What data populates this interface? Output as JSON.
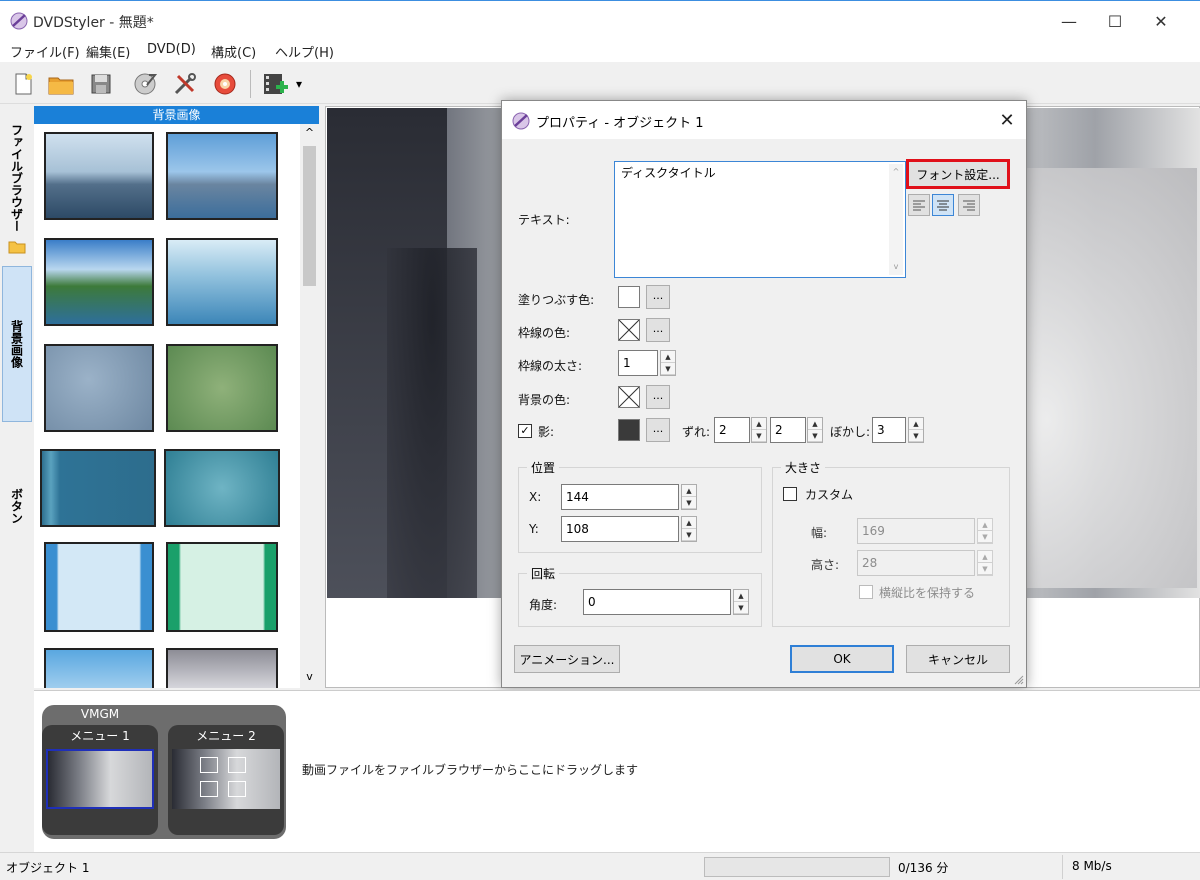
{
  "window": {
    "title": "DVDStyler - 無題*",
    "controls": {
      "minimize": "—",
      "maximize": "☐",
      "close": "✕"
    }
  },
  "menubar": [
    "ファイル(F)",
    "編集(E)",
    "DVD(D)",
    "構成(C)",
    "ヘルプ(H)"
  ],
  "toolbar": {
    "icons": [
      "new-file-icon",
      "open-folder-icon",
      "save-icon",
      "burn-disc-icon",
      "settings-tools-icon",
      "dvd-disc-icon",
      "add-video-icon"
    ],
    "dropdown": "▾"
  },
  "left_tabs": [
    "ファイルブラウザー",
    "背景画像",
    "ボタン"
  ],
  "thumbnail_panel": {
    "header": "背景画像",
    "scroll_up": "^",
    "scroll_down": "v"
  },
  "dialog": {
    "title": "プロパティ - オブジェクト 1",
    "close": "✕",
    "text_label": "テキスト:",
    "text_value": "ディスクタイトル",
    "font_button": "フォント設定...",
    "fill_color_label": "塗りつぶす色:",
    "border_color_label": "枠線の色:",
    "border_width_label": "枠線の太さ:",
    "border_width_value": "1",
    "bg_color_label": "背景の色:",
    "shadow_label": "影:",
    "shadow_checked": "✓",
    "shadow_color": "#3a3a3a",
    "offset_label": "ずれ:",
    "offset_x": "2",
    "offset_y": "2",
    "blur_label": "ぼかし:",
    "blur_value": "3",
    "ellipsis": "...",
    "position": {
      "title": "位置",
      "x_label": "X:",
      "x_value": "144",
      "y_label": "Y:",
      "y_value": "108"
    },
    "size": {
      "title": "大きさ",
      "custom_label": "カスタム",
      "width_label": "幅:",
      "width_value": "169",
      "height_label": "高さ:",
      "height_value": "28",
      "keep_ratio_label": "横縦比を保持する"
    },
    "rotation": {
      "title": "回転",
      "angle_label": "角度:",
      "angle_value": "0"
    },
    "animation_button": "アニメーション...",
    "ok_button": "OK",
    "cancel_button": "キャンセル"
  },
  "bottom": {
    "vmgm_label": "VMGM",
    "menu1_label": "メニュー 1",
    "menu2_label": "メニュー 2",
    "drop_hint": "動画ファイルをファイルブラウザーからここにドラッグします"
  },
  "statusbar": {
    "left": "オブジェクト 1",
    "duration": "0/136 分",
    "bitrate": "8 Mb/s"
  },
  "colors": {
    "accent": "#1a80d8",
    "highlight_border": "#e0101a",
    "ok_border": "#2f7fd6"
  }
}
